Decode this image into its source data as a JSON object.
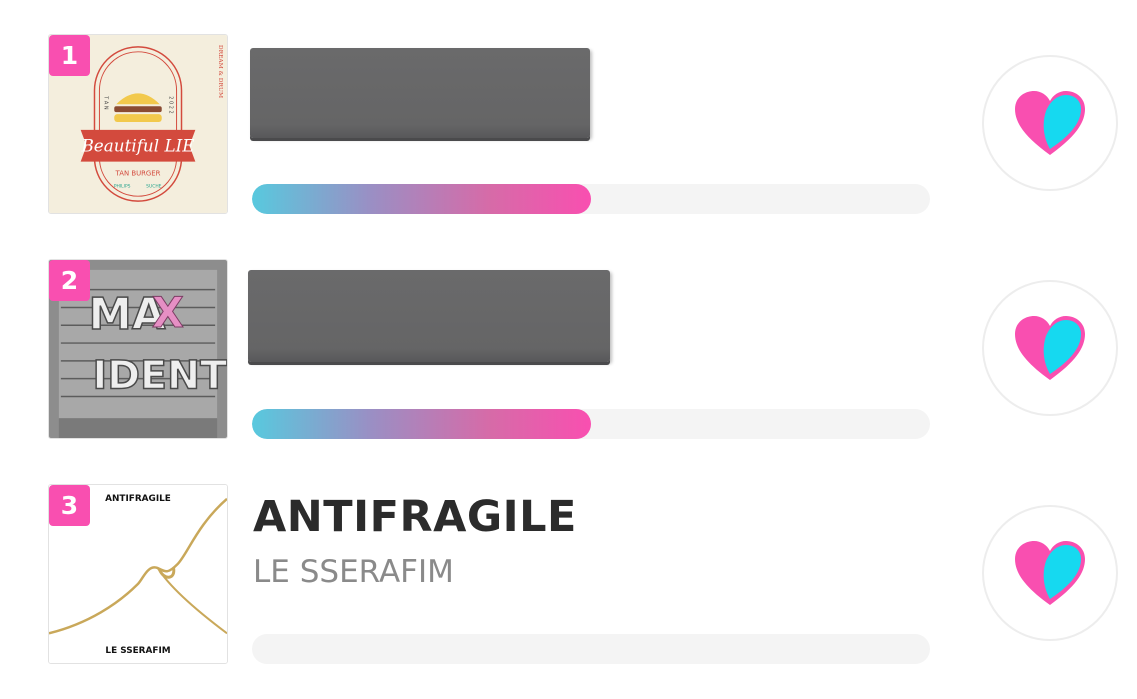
{
  "colors": {
    "accent_pink": "#f94fb0",
    "accent_cyan": "#16d9f0",
    "bar_track": "#f4f4f4",
    "censor_gray": "#666667"
  },
  "ranking": [
    {
      "rank": "1",
      "title": "",
      "artist": "",
      "title_redacted": true,
      "vote_share": 0.5,
      "cover": {
        "icon": "burger-album-cover",
        "lines": [
          "Beautiful LIE",
          "TAN BURGER",
          "DREAM & DRUM",
          "T A N",
          "2 0 2 2",
          "PHILIPS",
          "SUCHE"
        ]
      },
      "vote_icon": "heart-icon"
    },
    {
      "rank": "2",
      "title": "",
      "artist": "",
      "title_redacted": true,
      "vote_share": 0.5,
      "cover": {
        "icon": "maxident-album-cover",
        "lines": [
          "MA",
          "X",
          "IDENT"
        ]
      },
      "vote_icon": "heart-icon"
    },
    {
      "rank": "3",
      "title": "ANTIFRAGILE",
      "artist": "LE SSERAFIM",
      "title_redacted": false,
      "vote_share": 0,
      "cover": {
        "icon": "antifragile-album-cover",
        "lines": [
          "ANTIFRAGILE",
          "LE SSERAFIM"
        ]
      },
      "vote_icon": "heart-icon"
    }
  ]
}
